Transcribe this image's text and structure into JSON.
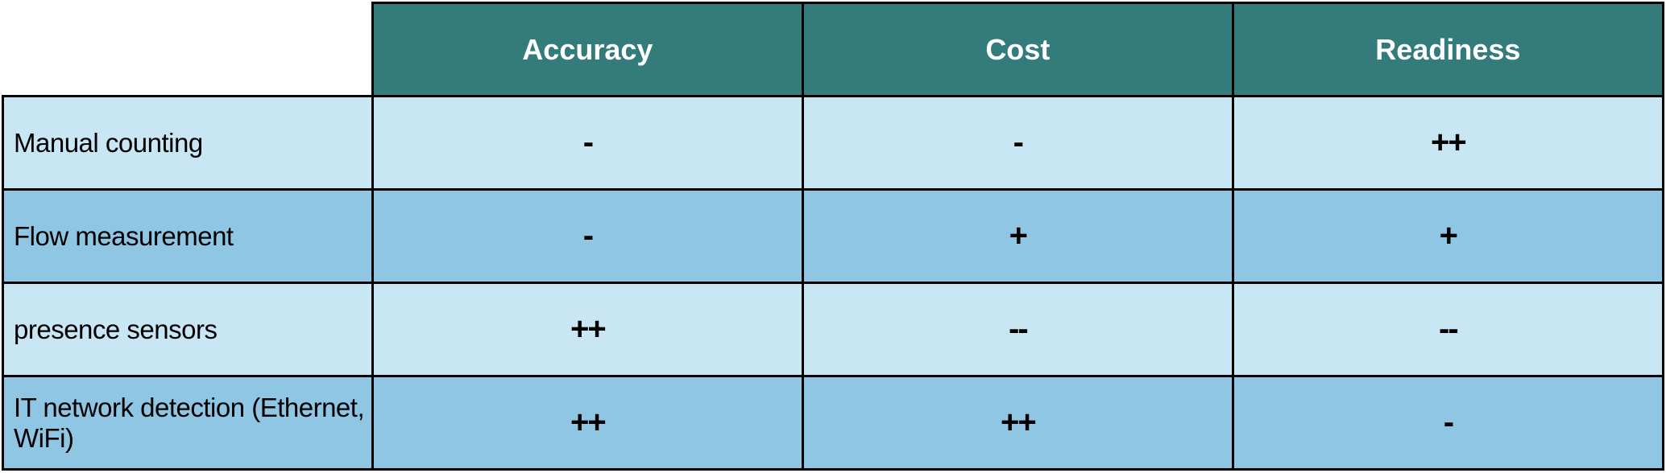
{
  "chart_data": {
    "type": "table",
    "title": "",
    "columns": [
      "Accuracy",
      "Cost",
      "Readiness"
    ],
    "rows": [
      {
        "label": "Manual counting",
        "values": [
          "-",
          "-",
          "++"
        ]
      },
      {
        "label": "Flow measurement",
        "values": [
          "-",
          "+",
          "+"
        ]
      },
      {
        "label": "presence sensors",
        "values": [
          "++",
          "--",
          "--"
        ]
      },
      {
        "label": "IT network detection (Ethernet, WiFi)",
        "values": [
          "++",
          "++",
          "-"
        ]
      }
    ]
  },
  "colors": {
    "header_bg": "#347b7c",
    "header_fg": "#ffffff",
    "row_light": "#c9e6f4",
    "row_dark": "#8fc6e3",
    "border": "#000000"
  }
}
